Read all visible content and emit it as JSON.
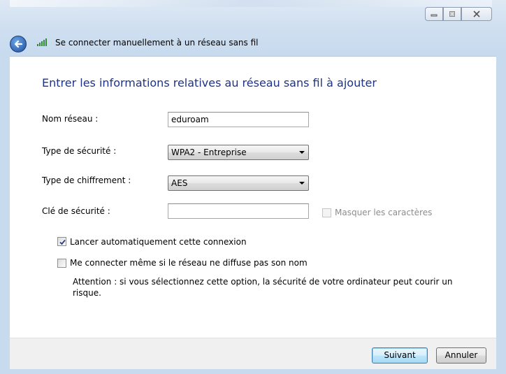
{
  "window": {
    "title": "Se connecter manuellement à un réseau sans fil",
    "controls": {
      "minimize_icon": "minimize-icon",
      "maximize_icon": "maximize-icon",
      "close_icon": "close-icon"
    }
  },
  "main": {
    "heading": "Entrer les informations relatives au réseau sans fil à ajouter",
    "fields": {
      "network_name_label": "Nom réseau :",
      "network_name_value": "eduroam",
      "security_type_label": "Type de sécurité :",
      "security_type_value": "WPA2 - Entreprise",
      "encryption_type_label": "Type de chiffrement :",
      "encryption_type_value": "AES",
      "security_key_label": "Clé de sécurité :",
      "security_key_value": "",
      "hide_characters_label": "Masquer les caractères"
    },
    "options": {
      "auto_connect_label": "Lancer automatiquement cette connexion",
      "auto_connect_checked": true,
      "connect_hidden_label": "Me connecter même si le réseau ne diffuse pas son nom",
      "connect_hidden_checked": false,
      "warning_text": "Attention : si vous sélectionnez cette option, la sécurité de votre ordinateur peut courir un risque."
    }
  },
  "footer": {
    "next_label": "Suivant",
    "cancel_label": "Annuler"
  },
  "colors": {
    "heading": "#1e3287",
    "frame": "#c7daee",
    "default_button_border": "#3c7fb1"
  }
}
